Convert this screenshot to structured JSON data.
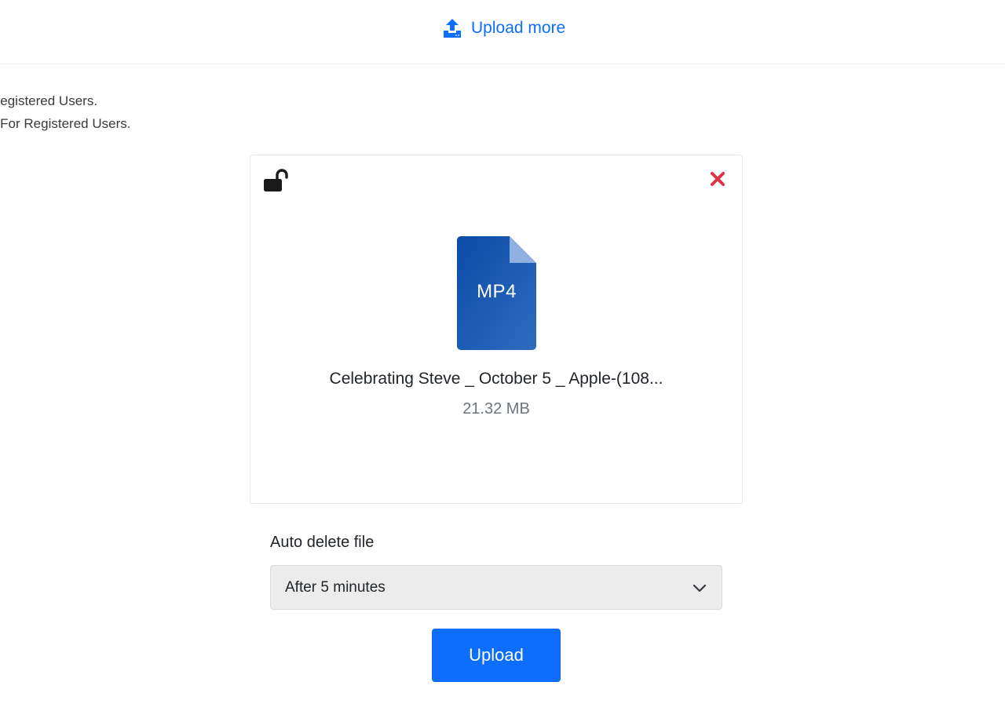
{
  "header": {
    "upload_more_label": "Upload more",
    "upload_icon": "upload-tray-icon"
  },
  "notes": {
    "line1": "Registered Users.",
    "line2": "d For Registered Users."
  },
  "file": {
    "lock_icon": "unlocked-padlock-icon",
    "remove_icon": "close-icon",
    "type_label": "MP4",
    "name": "Celebrating Steve _ October 5 _ Apple-(108...",
    "size": "21.32 MB"
  },
  "auto_delete": {
    "label": "Auto delete file",
    "selected": "After 5 minutes",
    "dropdown_icon": "chevron-down-icon"
  },
  "actions": {
    "upload_label": "Upload"
  },
  "colors": {
    "accent": "#0d6efd",
    "remove": "#dc3545",
    "file_icon_top": "#0b4aa8",
    "file_icon_bottom": "#2f6cc0",
    "file_icon_fold": "#8fb0e0",
    "select_bg": "#ececec"
  }
}
